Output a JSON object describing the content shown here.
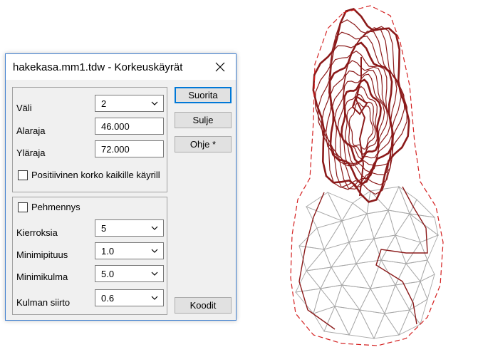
{
  "dialog": {
    "title": "hakekasa.mm1.tdw - Korkeuskäyrät",
    "vali_label": "Väli",
    "vali_value": "2",
    "alaraja_label": "Alaraja",
    "alaraja_value": "46.000",
    "ylaraja_label": "Yläraja",
    "ylaraja_value": "72.000",
    "positive_label": "Positiivinen korko kaikille käyrill",
    "positive_checked": false,
    "pehmennys_label": "Pehmennys",
    "pehmennys_checked": false,
    "kierroksia_label": "Kierroksia",
    "kierroksia_value": "5",
    "minimipituus_label": "Minimipituus",
    "minimipituus_value": "1.0",
    "minimikulma_label": "Minimikulma",
    "minimikulma_value": "5.0",
    "kulman_label": "Kulman siirto",
    "kulman_value": "0.6",
    "buttons": {
      "suorita": "Suorita",
      "sulje": "Sulje",
      "ohje": "Ohje *",
      "koodit": "Koodit"
    }
  },
  "colors": {
    "contour": "#8b1a1a",
    "boundary": "#d42020",
    "mesh": "#a8a8a8",
    "accent": "#0078d7"
  },
  "icons": [
    "close-icon",
    "chevron-down-icon",
    "checkbox-icon"
  ]
}
